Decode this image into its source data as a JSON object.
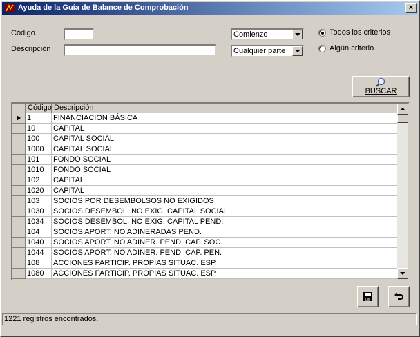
{
  "window": {
    "title": "Ayuda de la Guía de Balance de Comprobación",
    "close_label": "×"
  },
  "filters": {
    "codigo_label": "Código",
    "descripcion_label": "Descripción",
    "codigo_value": "",
    "descripcion_value": "",
    "match_position": {
      "selected": "Comienzo"
    },
    "match_scope": {
      "selected": "Cualquier parte"
    },
    "criteria": [
      {
        "label": "Todos los criterios",
        "checked": true
      },
      {
        "label": "Algún criterio",
        "checked": false
      }
    ]
  },
  "search_button": {
    "label": "BUSCAR"
  },
  "grid": {
    "columns": [
      "Código",
      "Descripción"
    ],
    "selected_row": 0,
    "rows": [
      {
        "codigo": "1",
        "descripcion": "FINANCIACION BÁSICA"
      },
      {
        "codigo": "10",
        "descripcion": "CAPITAL"
      },
      {
        "codigo": "100",
        "descripcion": "CAPITAL SOCIAL"
      },
      {
        "codigo": "1000",
        "descripcion": "CAPITAL SOCIAL"
      },
      {
        "codigo": "101",
        "descripcion": "FONDO SOCIAL"
      },
      {
        "codigo": "1010",
        "descripcion": "FONDO SOCIAL"
      },
      {
        "codigo": "102",
        "descripcion": "CAPITAL"
      },
      {
        "codigo": "1020",
        "descripcion": "CAPITAL"
      },
      {
        "codigo": "103",
        "descripcion": "SOCIOS POR DESEMBOLSOS NO EXIGIDOS"
      },
      {
        "codigo": "1030",
        "descripcion": "SOCIOS DESEMBOL. NO EXIG. CAPITAL SOCIAL"
      },
      {
        "codigo": "1034",
        "descripcion": "SOCIOS DESEMBOL. NO EXIG. CAPITAL PEND."
      },
      {
        "codigo": "104",
        "descripcion": "SOCIOS APORT. NO ADINERADAS PEND."
      },
      {
        "codigo": "1040",
        "descripcion": "SOCIOS APORT. NO ADINER. PEND. CAP. SOC."
      },
      {
        "codigo": "1044",
        "descripcion": "SOCIOS APORT. NO ADINER. PEND. CAP. PEN."
      },
      {
        "codigo": "108",
        "descripcion": "ACCIONES PARTICIP. PROPIAS SITUAC. ESP."
      },
      {
        "codigo": "1080",
        "descripcion": "ACCIONES PARTICIP. PROPIAS SITUAC. ESP."
      }
    ]
  },
  "status": {
    "text": "1221 registros encontrados."
  },
  "icons": {
    "search": "magnifier-icon",
    "save": "floppy-disk-icon",
    "undo": "undo-arrow-icon"
  }
}
